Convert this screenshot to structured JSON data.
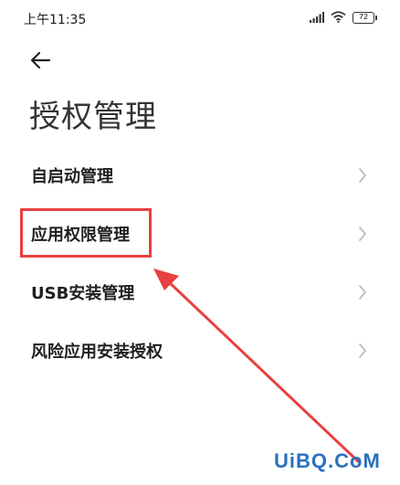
{
  "status_bar": {
    "time": "上午11:35",
    "battery": "72",
    "icons": [
      "signal-icon",
      "wifi-icon",
      "battery-icon"
    ]
  },
  "header": {
    "back_icon": "arrow-left-icon",
    "title": "授权管理"
  },
  "menu": {
    "items": [
      {
        "label": "自启动管理"
      },
      {
        "label": "应用权限管理"
      },
      {
        "label": "USB安装管理"
      },
      {
        "label": "风险应用安装授权"
      }
    ]
  },
  "annotation": {
    "highlight_color": "#e8413f",
    "highlighted_item": "应用权限管理"
  },
  "watermark": {
    "text": "UiBQ.CoM"
  }
}
